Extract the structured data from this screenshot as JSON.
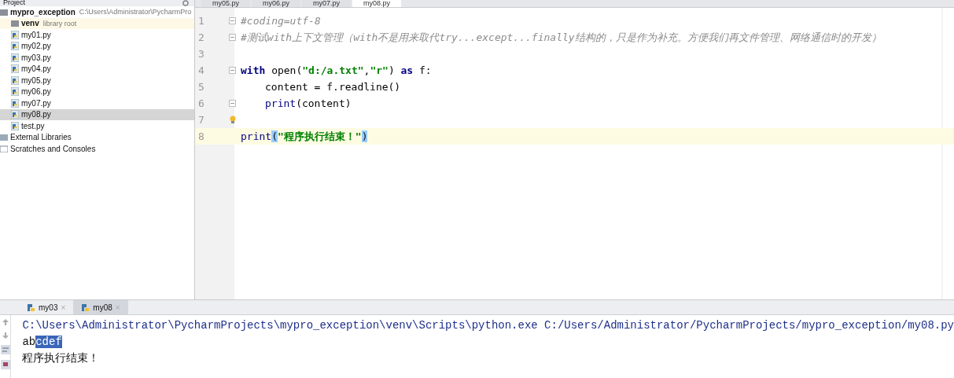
{
  "project_panel": {
    "title": "Project",
    "tree": [
      {
        "label": "mypro_exception",
        "hint": "C:\\Users\\Administrator\\PycharmPro",
        "kind": "project",
        "selected": false,
        "children": [
          {
            "label": "venv",
            "hint": "library root",
            "kind": "folder",
            "selected": false,
            "highlighted": true
          },
          {
            "label": "my01.py",
            "kind": "pyfile",
            "selected": false
          },
          {
            "label": "my02.py",
            "kind": "pyfile",
            "selected": false
          },
          {
            "label": "my03.py",
            "kind": "pyfile",
            "selected": false
          },
          {
            "label": "my04.py",
            "kind": "pyfile",
            "selected": false
          },
          {
            "label": "my05.py",
            "kind": "pyfile",
            "selected": false
          },
          {
            "label": "my06.py",
            "kind": "pyfile",
            "selected": false
          },
          {
            "label": "my07.py",
            "kind": "pyfile",
            "selected": false
          },
          {
            "label": "my08.py",
            "kind": "pyfile",
            "selected": true
          },
          {
            "label": "test.py",
            "kind": "pyfile",
            "selected": false
          }
        ]
      },
      {
        "label": "External Libraries",
        "kind": "library",
        "selected": false
      },
      {
        "label": "Scratches and Consoles",
        "kind": "scratch",
        "selected": false
      }
    ]
  },
  "editor_tabs": [
    {
      "label": "my05.py",
      "selected": false
    },
    {
      "label": "my06.py",
      "selected": false
    },
    {
      "label": "my07.py",
      "selected": false
    },
    {
      "label": "my08.py",
      "selected": true
    }
  ],
  "code_lines": [
    {
      "number": "1",
      "fold": true,
      "current": false,
      "tokens": [
        {
          "text": "#coding=utf-8",
          "kind": "comment"
        }
      ]
    },
    {
      "number": "2",
      "fold": true,
      "current": false,
      "tokens": [
        {
          "text": "#测试with上下文管理（with不是用来取代try...except...finally结构的，只是作为补充。方便我们再文件管理、网络通信时的开发）",
          "kind": "comment"
        }
      ]
    },
    {
      "number": "3",
      "fold": false,
      "current": false
    },
    {
      "number": "4",
      "fold": true,
      "current": false,
      "tokens": [
        {
          "text": "with",
          "kind": "keyword"
        },
        {
          "text": " open(",
          "kind": "plain"
        },
        {
          "text": "\"d:/a.txt\"",
          "kind": "string"
        },
        {
          "text": ",",
          "kind": "plain"
        },
        {
          "text": "\"r\"",
          "kind": "string"
        },
        {
          "text": ")",
          "kind": "plain"
        },
        {
          "text": " as",
          "kind": "keyword"
        },
        {
          "text": " f:",
          "kind": "plain"
        }
      ]
    },
    {
      "number": "5",
      "fold": false,
      "current": false,
      "indent": true,
      "tokens": [
        {
          "text": "content = f.readline()",
          "kind": "plain"
        }
      ]
    },
    {
      "number": "6",
      "fold": true,
      "current": false,
      "indent": true,
      "tokens": [
        {
          "text": "print",
          "kind": "builtin"
        },
        {
          "text": "(content)",
          "kind": "plain"
        }
      ]
    },
    {
      "number": "7",
      "fold": false,
      "current": false,
      "bulb": true
    },
    {
      "number": "8",
      "fold": false,
      "current": true,
      "tokens": [
        {
          "text": "print",
          "kind": "builtin"
        },
        {
          "text": "(",
          "kind": "brace"
        },
        {
          "text": "\"程序执行结束！\"",
          "kind": "string"
        },
        {
          "text": ")",
          "kind": "brace"
        }
      ]
    }
  ],
  "run_tabs": [
    {
      "label": "my03",
      "close": "×",
      "selected": false
    },
    {
      "label": "my08",
      "close": "×",
      "selected": true
    }
  ],
  "console_lines": [
    {
      "kind": "command",
      "segments": [
        {
          "text": "C:\\Users\\Administrator\\PycharmProjects\\mypro_exception\\venv\\Scripts\\python.exe C:/Users/Administrator/PycharmProjects/mypro_exception/my08.py",
          "selected": false
        }
      ]
    },
    {
      "kind": "output",
      "segments": [
        {
          "text": "ab",
          "selected": false
        },
        {
          "text": "cdef",
          "selected": true
        }
      ]
    },
    {
      "kind": "output",
      "segments": [
        {
          "text": "程序执行结束！",
          "selected": false
        }
      ]
    }
  ]
}
